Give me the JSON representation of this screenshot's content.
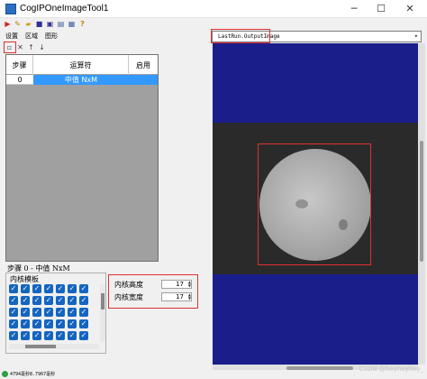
{
  "window": {
    "title": "CogIPOneImageTool1",
    "minimize_glyph": "─",
    "maximize_glyph": "☐",
    "close_glyph": "✕"
  },
  "toolbar": {
    "icons": [
      "run-icon",
      "pencil-icon",
      "open-folder-icon",
      "save-icon",
      "save-as-icon",
      "image-icon",
      "grid-icon",
      "help-icon"
    ]
  },
  "menu": {
    "items": [
      "设置",
      "区域",
      "图形"
    ]
  },
  "mini_toolbar": {
    "add_glyph": "▫",
    "delete_glyph": "✕",
    "up_glyph": "↑",
    "down_glyph": "↓"
  },
  "operator_table": {
    "columns": [
      "步骤",
      "运算符",
      "启用"
    ],
    "rows": [
      {
        "step": "0",
        "operator": "中值 NxM",
        "enabled": ""
      }
    ]
  },
  "step_status": "步骤  0  -  中值  NxM",
  "kernel_panel": {
    "title": "内核模板",
    "check_glyph": "✓"
  },
  "params": {
    "kernel_height_label": "内核高度",
    "kernel_height_value": "17",
    "kernel_width_label": "内核宽度",
    "kernel_width_value": "17"
  },
  "image_view": {
    "selected_image": "LastRun.OutputImage",
    "dropdown_glyph": "▾"
  },
  "status_bar": {
    "text": "4794毫秒8.7967毫秒"
  },
  "watermark": "CSDN @heyheyhey_",
  "colors": {
    "selection_blue": "#3399ff",
    "highlight_red": "#e03030",
    "image_background": "#1a1e8a",
    "checkbox_blue": "#1565c0"
  }
}
